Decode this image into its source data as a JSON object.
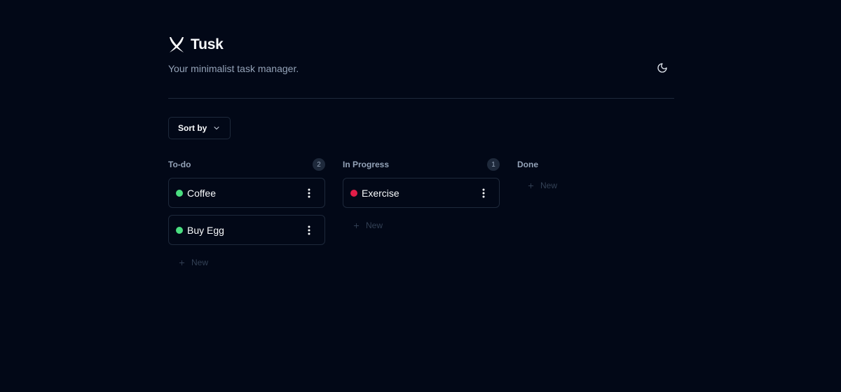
{
  "app": {
    "name": "Tusk",
    "tagline": "Your minimalist task manager."
  },
  "toolbar": {
    "sort_label": "Sort by"
  },
  "columns": [
    {
      "title": "To-do",
      "count": "2",
      "tasks": [
        {
          "title": "Coffee",
          "status_color": "#4ade80"
        },
        {
          "title": "Buy Egg",
          "status_color": "#4ade80"
        }
      ],
      "new_label": "New"
    },
    {
      "title": "In Progress",
      "count": "1",
      "tasks": [
        {
          "title": "Exercise",
          "status_color": "#e11d48"
        }
      ],
      "new_label": "New"
    },
    {
      "title": "Done",
      "tasks": [],
      "new_label": "New"
    }
  ],
  "colors": {
    "background": "#020817",
    "border": "#1e293b",
    "muted_text": "#94a3b8",
    "status_green": "#4ade80",
    "status_red": "#e11d48"
  },
  "icons": {
    "logo": "tusk-logo-icon",
    "theme_toggle": "moon-icon",
    "sort_chevron": "chevron-down-icon",
    "card_menu": "more-vertical-icon",
    "new": "plus-icon"
  }
}
